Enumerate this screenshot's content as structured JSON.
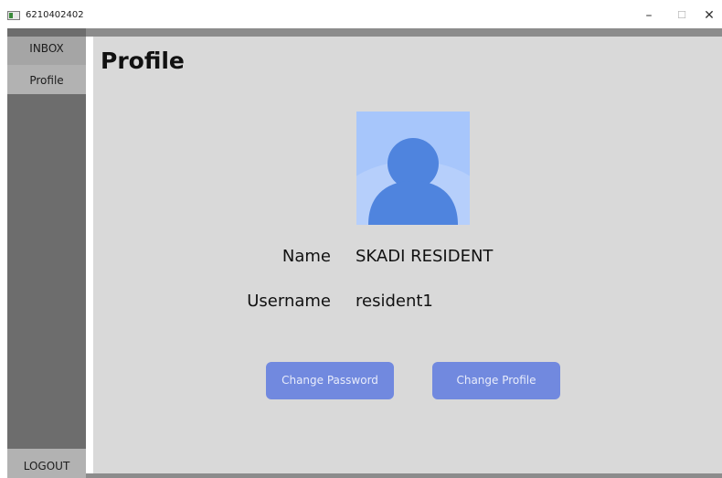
{
  "window": {
    "title": "6210402402",
    "minimize_glyph": "–",
    "maximize_glyph": "☐",
    "close_glyph": "✕"
  },
  "sidebar": {
    "items": [
      {
        "label": "INBOX"
      },
      {
        "label": "Profile"
      }
    ],
    "logout_label": "LOGOUT"
  },
  "main": {
    "title": "Profile",
    "avatar_icon": "user-avatar-icon",
    "fields": [
      {
        "label": "Name",
        "value": "SKADI RESIDENT"
      },
      {
        "label": "Username",
        "value": "resident1"
      }
    ],
    "buttons": {
      "change_password": "Change Password",
      "change_profile": "Change Profile"
    }
  },
  "colors": {
    "sidebar": "#6d6d6d",
    "content": "#d9d9d9",
    "button": "#7189df",
    "avatar_bg": "#a7c6fb",
    "avatar_fg": "#4f84de"
  }
}
